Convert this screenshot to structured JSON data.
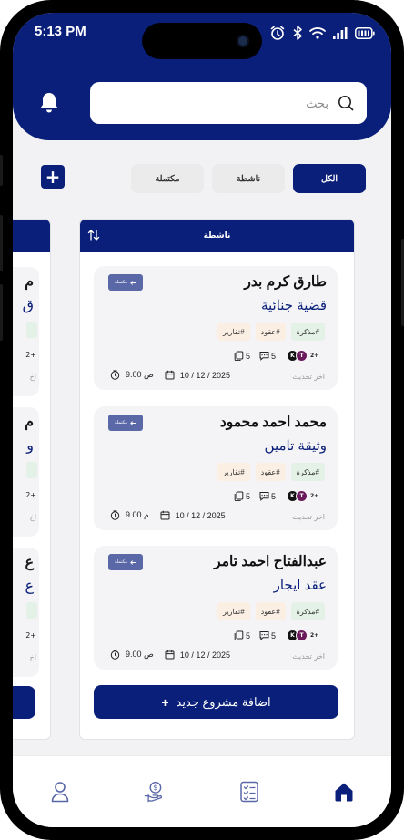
{
  "status_bar": {
    "time": "5:13 PM"
  },
  "search": {
    "placeholder": "بحث"
  },
  "filters": {
    "all": "الكل",
    "active": "ناشطة",
    "completed": "مكتملة"
  },
  "column": {
    "title": "ناشطة"
  },
  "projects": [
    {
      "status": "مكتملة",
      "client": "طارق كرم بدر",
      "type": "قضية جنائية",
      "tags": [
        "#مذكرة",
        "#عقود",
        "#تقارير"
      ],
      "avatars": [
        "T",
        "K"
      ],
      "more": "2+",
      "comments": "5",
      "files": "5",
      "updated_label": "اخر تحديث",
      "date": "10 / 12 / 2025",
      "time": "9.00 ص"
    },
    {
      "status": "مكتملة",
      "client": "محمد احمد محمود",
      "type": "وثيقة تامين",
      "tags": [
        "#مذكرة",
        "#عقود",
        "#تقارير"
      ],
      "avatars": [
        "T",
        "K"
      ],
      "more": "2+",
      "comments": "5",
      "files": "5",
      "updated_label": "اخر تحديث",
      "date": "10 / 12 / 2025",
      "time": "9.00 م"
    },
    {
      "status": "مكتملة",
      "client": "عبدالفتاح احمد تامر",
      "type": "عقد ايجار",
      "tags": [
        "#مذكرة",
        "#عقود",
        "#تقارير"
      ],
      "avatars": [
        "T",
        "K"
      ],
      "more": "2+",
      "comments": "5",
      "files": "5",
      "updated_label": "اخر تحديث",
      "date": "10 / 12 / 2025",
      "time": "9.00 ص"
    }
  ],
  "add_project": {
    "label": "اضافة مشروع جديد"
  },
  "ghost_column": {
    "chars": [
      "م",
      "ق",
      "م",
      "و",
      "ع",
      "ع"
    ],
    "small": [
      "2+",
      "اخ"
    ]
  },
  "colors": {
    "primary": "#0a1f7a",
    "badge": "#5a68a8",
    "tag_green": "#e3f1e6",
    "tag_orange": "#fbefe4"
  },
  "nav": {
    "items": [
      "home-icon",
      "tasks-icon",
      "finance-icon",
      "profile-icon"
    ],
    "active": "home-icon"
  }
}
